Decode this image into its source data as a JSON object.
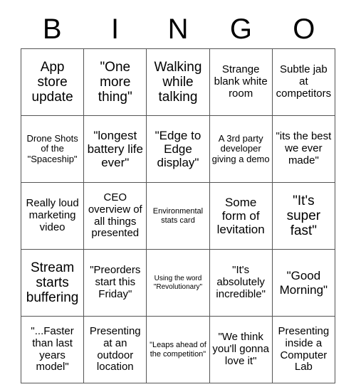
{
  "card": {
    "header_letters": [
      "B",
      "I",
      "N",
      "G",
      "O"
    ],
    "rows": [
      [
        {
          "text": "App store update",
          "size": "sz-xl"
        },
        {
          "text": "\"One more thing\"",
          "size": "sz-xl"
        },
        {
          "text": "Walking while talking",
          "size": "sz-xl"
        },
        {
          "text": "Strange blank white room",
          "size": "sz-md"
        },
        {
          "text": "Subtle jab at competitors",
          "size": "sz-md"
        }
      ],
      [
        {
          "text": "Drone Shots of the \"Spaceship\"",
          "size": "sz-sm"
        },
        {
          "text": "\"longest battery life ever\"",
          "size": "sz-lg"
        },
        {
          "text": "\"Edge to Edge display\"",
          "size": "sz-lg"
        },
        {
          "text": "A 3rd party developer giving a demo",
          "size": "sz-sm"
        },
        {
          "text": "\"its the best we ever made\"",
          "size": "sz-md"
        }
      ],
      [
        {
          "text": "Really loud marketing video",
          "size": "sz-md"
        },
        {
          "text": "CEO overview of all things presented",
          "size": "sz-md"
        },
        {
          "text": "Environmental stats card",
          "size": "sz-xs"
        },
        {
          "text": "Some form of levitation",
          "size": "sz-lg"
        },
        {
          "text": "\"It's super fast\"",
          "size": "sz-xl"
        }
      ],
      [
        {
          "text": "Stream starts buffering",
          "size": "sz-xl"
        },
        {
          "text": "\"Preorders start this Friday\"",
          "size": "sz-md"
        },
        {
          "text": "Using the word \"Revolutionary\"",
          "size": "sz-xxs"
        },
        {
          "text": "\"It's absolutely incredible\"",
          "size": "sz-md"
        },
        {
          "text": "\"Good Morning\"",
          "size": "sz-lg"
        }
      ],
      [
        {
          "text": "\"...Faster than last years model\"",
          "size": "sz-md"
        },
        {
          "text": "Presenting at an outdoor location",
          "size": "sz-md"
        },
        {
          "text": "\"Leaps ahead of the competition\"",
          "size": "sz-xs"
        },
        {
          "text": "\"We think you'll gonna love it\"",
          "size": "sz-md"
        },
        {
          "text": "Presenting inside a Computer Lab",
          "size": "sz-md"
        }
      ]
    ]
  }
}
